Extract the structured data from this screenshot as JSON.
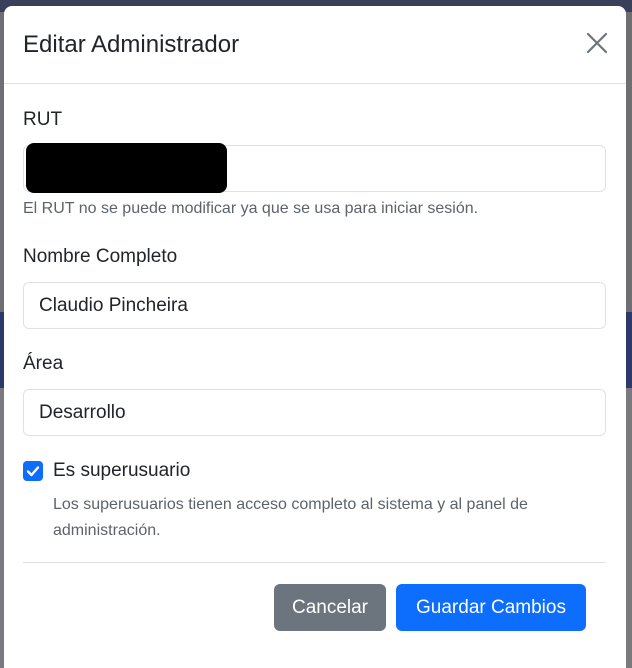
{
  "modal": {
    "title": "Editar Administrador",
    "close_icon": "close-icon"
  },
  "form": {
    "rut": {
      "label": "RUT",
      "value": "",
      "help": "El RUT no se puede modificar ya que se usa para iniciar sesión."
    },
    "nombre": {
      "label": "Nombre Completo",
      "value": "Claudio Pincheira"
    },
    "area": {
      "label": "Área",
      "value": "Desarrollo"
    },
    "superusuario": {
      "label": "Es superusuario",
      "checked": true,
      "help": "Los superusuarios tienen acceso completo al sistema y al panel de administración."
    }
  },
  "footer": {
    "cancel_label": "Cancelar",
    "save_label": "Guardar Cambios"
  },
  "colors": {
    "primary": "#0d6efd",
    "secondary": "#6c757d"
  }
}
